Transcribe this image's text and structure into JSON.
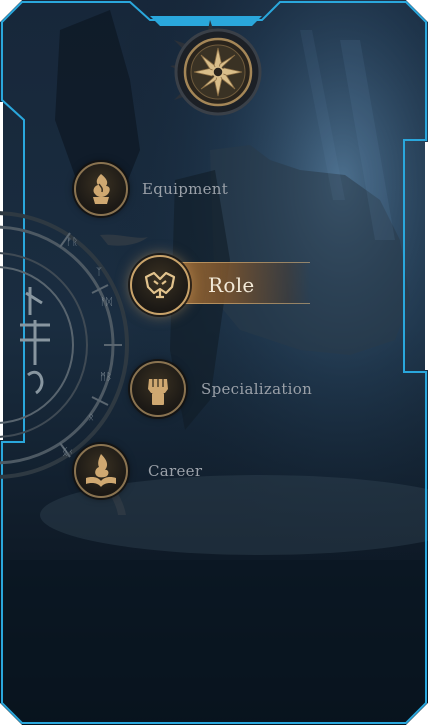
{
  "menu": {
    "items": [
      {
        "label": "Equipment",
        "icon": "flame-hand-icon",
        "active": false
      },
      {
        "label": "Role",
        "icon": "ornate-mask-icon",
        "active": true
      },
      {
        "label": "Specialization",
        "icon": "raised-fist-icon",
        "active": false
      },
      {
        "label": "Career",
        "icon": "open-book-flame-icon",
        "active": false
      }
    ]
  },
  "top_emblem": {
    "icon": "compass-star-icon"
  },
  "rune_wheel": {
    "icon": "rune-wheel-icon"
  },
  "colors": {
    "frame": "#2aa7dc",
    "accent": "#f3ead8",
    "active_band": "#a06e37",
    "medallion_rim": "#8a7350",
    "label_inactive": "#9aa0a8"
  }
}
